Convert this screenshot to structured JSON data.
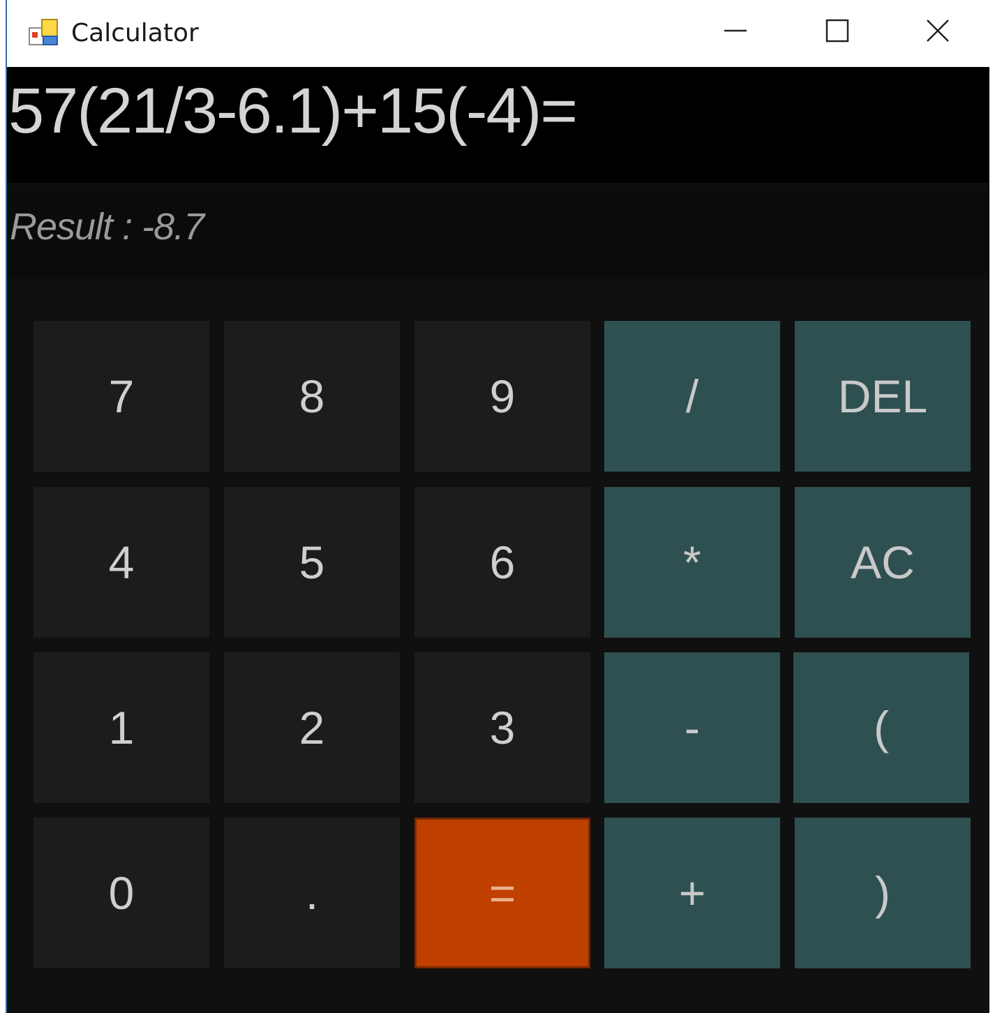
{
  "window": {
    "title": "Calculator",
    "controls": {
      "minimize": "minimize-icon",
      "maximize": "maximize-icon",
      "close": "close-icon"
    }
  },
  "display": {
    "expression": "57(21/3-6.1)+15(-4)=",
    "result": "Result : -8.7"
  },
  "keys": {
    "k7": "7",
    "k8": "8",
    "k9": "9",
    "div": "/",
    "del": "DEL",
    "k4": "4",
    "k5": "5",
    "k6": "6",
    "mul": "*",
    "ac": "AC",
    "k1": "1",
    "k2": "2",
    "k3": "3",
    "sub": "-",
    "lparen": "(",
    "k0": "0",
    "dot": ".",
    "eq": "=",
    "add": "+",
    "rparen": ")"
  },
  "colors": {
    "display_bg": "#000000",
    "keypad_bg": "#101010",
    "number_key": "#1c1c1c",
    "operator_key": "#2f5050",
    "equals_key": "#c04000"
  }
}
